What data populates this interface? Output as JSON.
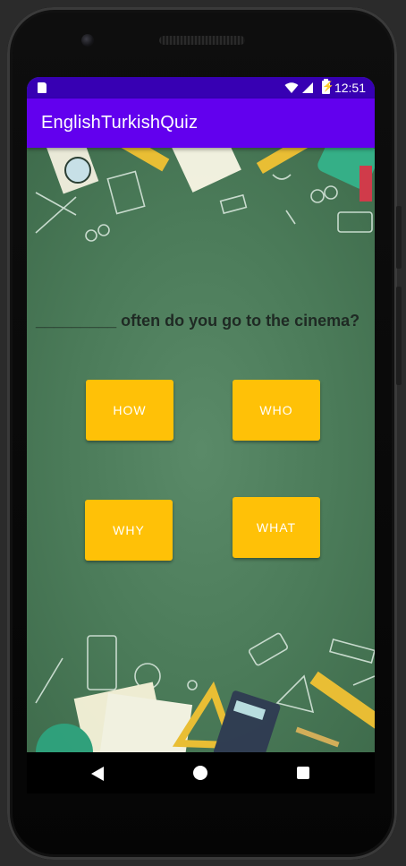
{
  "status_bar": {
    "time": "12:51",
    "icons": [
      "sd-card-icon",
      "wifi-icon",
      "signal-icon",
      "battery-charging-icon"
    ]
  },
  "app_bar": {
    "title": "EnglishTurkishQuiz"
  },
  "quiz": {
    "question": "_________ often do you go to the cinema?",
    "options": [
      "HOW",
      "WHO",
      "WHY",
      "WHAT"
    ]
  },
  "nav_bar": {
    "icons": [
      "back-icon",
      "home-icon",
      "recents-icon"
    ]
  },
  "colors": {
    "status_bar": "#3700b3",
    "app_bar": "#6200ee",
    "button": "#ffc107",
    "background": "#4a7a58"
  }
}
